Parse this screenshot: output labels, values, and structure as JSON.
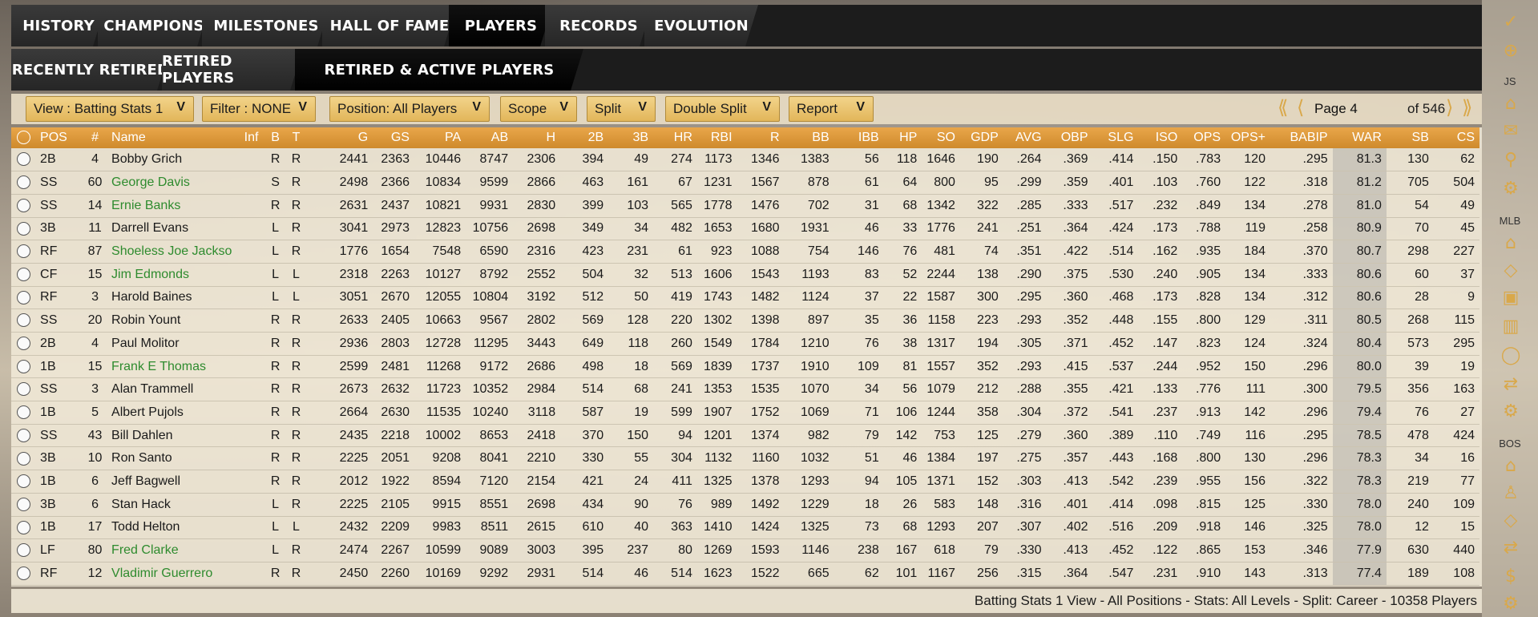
{
  "tabs_row1": [
    {
      "label": "HISTORY",
      "active": false
    },
    {
      "label": "CHAMPIONS",
      "active": false
    },
    {
      "label": "MILESTONES",
      "active": false
    },
    {
      "label": "HALL OF FAME",
      "active": false
    },
    {
      "label": "PLAYERS",
      "active": true
    },
    {
      "label": "RECORDS",
      "active": false
    },
    {
      "label": "EVOLUTION",
      "active": false
    }
  ],
  "tabs_row2": [
    {
      "label": "RECENTLY RETIRED",
      "active": false
    },
    {
      "label": "RETIRED PLAYERS",
      "active": false
    },
    {
      "label": "RETIRED & ACTIVE PLAYERS",
      "active": true
    }
  ],
  "filters": {
    "view": "View : Batting Stats 1",
    "filter": "Filter : NONE",
    "position": "Position: All Players",
    "scope": "Scope",
    "split": "Split",
    "double_split": "Double Split",
    "report": "Report"
  },
  "pager": {
    "first": "⟪",
    "prev": "⟨",
    "page_value": "Page 4",
    "of_label": "of 546",
    "next": "⟩",
    "last": "⟫"
  },
  "table": {
    "columns": [
      "POS",
      "#",
      "Name",
      "Inf",
      "B",
      "T",
      "G",
      "GS",
      "PA",
      "AB",
      "H",
      "2B",
      "3B",
      "HR",
      "RBI",
      "R",
      "BB",
      "IBB",
      "HP",
      "SO",
      "GDP",
      "AVG",
      "OBP",
      "SLG",
      "ISO",
      "OPS",
      "OPS+",
      "BABIP",
      "WAR",
      "SB",
      "CS"
    ],
    "rows": [
      {
        "green": false,
        "cells": [
          "2B",
          "4",
          "Bobby Grich",
          "",
          "R",
          "R",
          "2441",
          "2363",
          "10446",
          "8747",
          "2306",
          "394",
          "49",
          "274",
          "1173",
          "1346",
          "1383",
          "56",
          "118",
          "1646",
          "190",
          ".264",
          ".369",
          ".414",
          ".150",
          ".783",
          "120",
          ".295",
          "81.3",
          "130",
          "62"
        ]
      },
      {
        "green": true,
        "cells": [
          "SS",
          "60",
          "George Davis",
          "",
          "S",
          "R",
          "2498",
          "2366",
          "10834",
          "9599",
          "2866",
          "463",
          "161",
          "67",
          "1231",
          "1567",
          "878",
          "61",
          "64",
          "800",
          "95",
          ".299",
          ".359",
          ".401",
          ".103",
          ".760",
          "122",
          ".318",
          "81.2",
          "705",
          "504"
        ]
      },
      {
        "green": true,
        "cells": [
          "SS",
          "14",
          "Ernie Banks",
          "",
          "R",
          "R",
          "2631",
          "2437",
          "10821",
          "9931",
          "2830",
          "399",
          "103",
          "565",
          "1778",
          "1476",
          "702",
          "31",
          "68",
          "1342",
          "322",
          ".285",
          ".333",
          ".517",
          ".232",
          ".849",
          "134",
          ".278",
          "81.0",
          "54",
          "49"
        ]
      },
      {
        "green": false,
        "cells": [
          "3B",
          "11",
          "Darrell Evans",
          "",
          "L",
          "R",
          "3041",
          "2973",
          "12823",
          "10756",
          "2698",
          "349",
          "34",
          "482",
          "1653",
          "1680",
          "1931",
          "46",
          "33",
          "1776",
          "241",
          ".251",
          ".364",
          ".424",
          ".173",
          ".788",
          "119",
          ".258",
          "80.9",
          "70",
          "45"
        ]
      },
      {
        "green": true,
        "cells": [
          "RF",
          "87",
          "Shoeless Joe Jackso",
          "",
          "L",
          "R",
          "1776",
          "1654",
          "7548",
          "6590",
          "2316",
          "423",
          "231",
          "61",
          "923",
          "1088",
          "754",
          "146",
          "76",
          "481",
          "74",
          ".351",
          ".422",
          ".514",
          ".162",
          ".935",
          "184",
          ".370",
          "80.7",
          "298",
          "227"
        ]
      },
      {
        "green": true,
        "cells": [
          "CF",
          "15",
          "Jim Edmonds",
          "",
          "L",
          "L",
          "2318",
          "2263",
          "10127",
          "8792",
          "2552",
          "504",
          "32",
          "513",
          "1606",
          "1543",
          "1193",
          "83",
          "52",
          "2244",
          "138",
          ".290",
          ".375",
          ".530",
          ".240",
          ".905",
          "134",
          ".333",
          "80.6",
          "60",
          "37"
        ]
      },
      {
        "green": false,
        "cells": [
          "RF",
          "3",
          "Harold Baines",
          "",
          "L",
          "L",
          "3051",
          "2670",
          "12055",
          "10804",
          "3192",
          "512",
          "50",
          "419",
          "1743",
          "1482",
          "1124",
          "37",
          "22",
          "1587",
          "300",
          ".295",
          ".360",
          ".468",
          ".173",
          ".828",
          "134",
          ".312",
          "80.6",
          "28",
          "9"
        ]
      },
      {
        "green": false,
        "cells": [
          "SS",
          "20",
          "Robin Yount",
          "",
          "R",
          "R",
          "2633",
          "2405",
          "10663",
          "9567",
          "2802",
          "569",
          "128",
          "220",
          "1302",
          "1398",
          "897",
          "35",
          "36",
          "1158",
          "223",
          ".293",
          ".352",
          ".448",
          ".155",
          ".800",
          "129",
          ".311",
          "80.5",
          "268",
          "115"
        ]
      },
      {
        "green": false,
        "cells": [
          "2B",
          "4",
          "Paul Molitor",
          "",
          "R",
          "R",
          "2936",
          "2803",
          "12728",
          "11295",
          "3443",
          "649",
          "118",
          "260",
          "1549",
          "1784",
          "1210",
          "76",
          "38",
          "1317",
          "194",
          ".305",
          ".371",
          ".452",
          ".147",
          ".823",
          "124",
          ".324",
          "80.4",
          "573",
          "295"
        ]
      },
      {
        "green": true,
        "cells": [
          "1B",
          "15",
          "Frank E Thomas",
          "",
          "R",
          "R",
          "2599",
          "2481",
          "11268",
          "9172",
          "2686",
          "498",
          "18",
          "569",
          "1839",
          "1737",
          "1910",
          "109",
          "81",
          "1557",
          "352",
          ".293",
          ".415",
          ".537",
          ".244",
          ".952",
          "150",
          ".296",
          "80.0",
          "39",
          "19"
        ]
      },
      {
        "green": false,
        "cells": [
          "SS",
          "3",
          "Alan Trammell",
          "",
          "R",
          "R",
          "2673",
          "2632",
          "11723",
          "10352",
          "2984",
          "514",
          "68",
          "241",
          "1353",
          "1535",
          "1070",
          "34",
          "56",
          "1079",
          "212",
          ".288",
          ".355",
          ".421",
          ".133",
          ".776",
          "111",
          ".300",
          "79.5",
          "356",
          "163"
        ]
      },
      {
        "green": false,
        "cells": [
          "1B",
          "5",
          "Albert Pujols",
          "",
          "R",
          "R",
          "2664",
          "2630",
          "11535",
          "10240",
          "3118",
          "587",
          "19",
          "599",
          "1907",
          "1752",
          "1069",
          "71",
          "106",
          "1244",
          "358",
          ".304",
          ".372",
          ".541",
          ".237",
          ".913",
          "142",
          ".296",
          "79.4",
          "76",
          "27"
        ]
      },
      {
        "green": false,
        "cells": [
          "SS",
          "43",
          "Bill Dahlen",
          "",
          "R",
          "R",
          "2435",
          "2218",
          "10002",
          "8653",
          "2418",
          "370",
          "150",
          "94",
          "1201",
          "1374",
          "982",
          "79",
          "142",
          "753",
          "125",
          ".279",
          ".360",
          ".389",
          ".110",
          ".749",
          "116",
          ".295",
          "78.5",
          "478",
          "424"
        ]
      },
      {
        "green": false,
        "cells": [
          "3B",
          "10",
          "Ron Santo",
          "",
          "R",
          "R",
          "2225",
          "2051",
          "9208",
          "8041",
          "2210",
          "330",
          "55",
          "304",
          "1132",
          "1160",
          "1032",
          "51",
          "46",
          "1384",
          "197",
          ".275",
          ".357",
          ".443",
          ".168",
          ".800",
          "130",
          ".296",
          "78.3",
          "34",
          "16"
        ]
      },
      {
        "green": false,
        "cells": [
          "1B",
          "6",
          "Jeff Bagwell",
          "",
          "R",
          "R",
          "2012",
          "1922",
          "8594",
          "7120",
          "2154",
          "421",
          "24",
          "411",
          "1325",
          "1378",
          "1293",
          "94",
          "105",
          "1371",
          "152",
          ".303",
          ".413",
          ".542",
          ".239",
          ".955",
          "156",
          ".322",
          "78.3",
          "219",
          "77"
        ]
      },
      {
        "green": false,
        "cells": [
          "3B",
          "6",
          "Stan Hack",
          "",
          "L",
          "R",
          "2225",
          "2105",
          "9915",
          "8551",
          "2698",
          "434",
          "90",
          "76",
          "989",
          "1492",
          "1229",
          "18",
          "26",
          "583",
          "148",
          ".316",
          ".401",
          ".414",
          ".098",
          ".815",
          "125",
          ".330",
          "78.0",
          "240",
          "109"
        ]
      },
      {
        "green": false,
        "cells": [
          "1B",
          "17",
          "Todd Helton",
          "",
          "L",
          "L",
          "2432",
          "2209",
          "9983",
          "8511",
          "2615",
          "610",
          "40",
          "363",
          "1410",
          "1424",
          "1325",
          "73",
          "68",
          "1293",
          "207",
          ".307",
          ".402",
          ".516",
          ".209",
          ".918",
          "146",
          ".325",
          "78.0",
          "12",
          "15"
        ]
      },
      {
        "green": true,
        "cells": [
          "LF",
          "80",
          "Fred Clarke",
          "",
          "L",
          "R",
          "2474",
          "2267",
          "10599",
          "9089",
          "3003",
          "395",
          "237",
          "80",
          "1269",
          "1593",
          "1146",
          "238",
          "167",
          "618",
          "79",
          ".330",
          ".413",
          ".452",
          ".122",
          ".865",
          "153",
          ".346",
          "77.9",
          "630",
          "440"
        ]
      },
      {
        "green": true,
        "cells": [
          "RF",
          "12",
          "Vladimir Guerrero",
          "",
          "R",
          "R",
          "2450",
          "2260",
          "10169",
          "9292",
          "2931",
          "514",
          "46",
          "514",
          "1623",
          "1522",
          "665",
          "62",
          "101",
          "1167",
          "256",
          ".315",
          ".364",
          ".547",
          ".231",
          ".910",
          "143",
          ".313",
          "77.4",
          "189",
          "108"
        ]
      }
    ]
  },
  "status_text": "Batting Stats 1 View - All Positions - Stats: All Levels - Split: Career - 10358 Players",
  "sidebar": {
    "label_js": "JS",
    "label_mlb": "MLB",
    "label_bos": "BOS"
  },
  "colors": {
    "header_orange": "#d9902f",
    "accent_gold": "#d9a84a",
    "player_link_green": "#2e8b2e",
    "tab_dark": "#262626"
  }
}
